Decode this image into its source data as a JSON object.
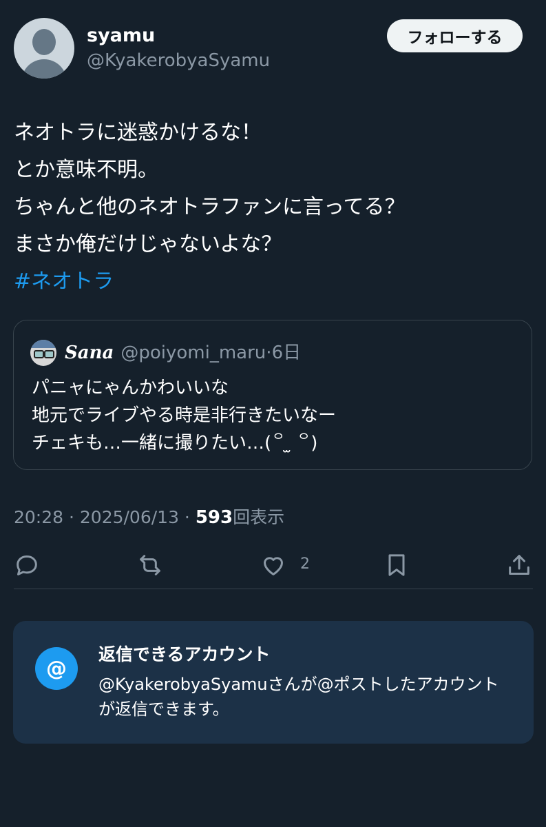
{
  "author": {
    "display_name": "syamu",
    "handle": "@KyakerobyaSyamu",
    "follow_label": "フォローする"
  },
  "tweet": {
    "lines": [
      "ネオトラに迷惑かけるな！",
      "とか意味不明。",
      "ちゃんと他のネオトラファンに言ってる？",
      "まさか俺だけじゃないよな？"
    ],
    "hashtag": "#ネオトラ"
  },
  "quote": {
    "display_name": "𝑺𝒂𝒏𝒂",
    "handle": "@poiyomi_maru",
    "separator": "·",
    "time": "6日",
    "lines": [
      "パニャにゃんかわいいな",
      "地元でライブやる時是非行きたいなー",
      "チェキも…一緒に撮りたい…(꒪ ̫ ꒪)"
    ]
  },
  "meta": {
    "time": "20:28",
    "sep1": " · ",
    "date": "2025/06/13",
    "sep2": " · ",
    "views_count": "593",
    "views_label": "回表示"
  },
  "actions": {
    "like_count": "2",
    "icons": [
      "reply-icon",
      "retweet-icon",
      "like-icon",
      "bookmark-icon",
      "share-icon"
    ]
  },
  "reply_restriction": {
    "icon_glyph": "@",
    "title": "返信できるアカウント",
    "description": "@KyakerobyaSyamuさんが@ポストしたアカウントが返信できます。"
  },
  "colors": {
    "background": "#15202b",
    "accent": "#1d9bf0",
    "muted": "#8b98a5",
    "card": "#1c3147"
  }
}
